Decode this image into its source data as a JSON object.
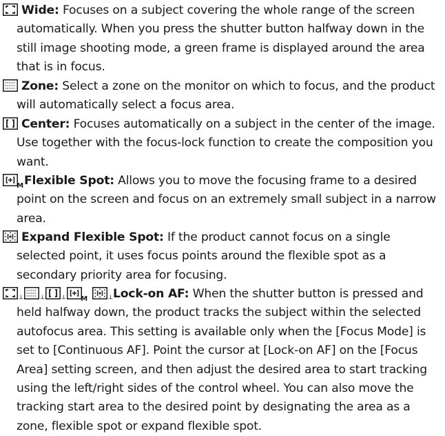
{
  "items": [
    {
      "icon": "wide-focus-area-icon",
      "term": "Wide:",
      "text": " Focuses on a subject covering the whole range of the screen automatically. When you press the shutter button halfway down in the still image shooting mode, a green frame is displayed around the area that is in focus."
    },
    {
      "icon": "zone-focus-area-icon",
      "term": "Zone:",
      "text": " Select a zone on the monitor on which to focus, and the product will automatically select a focus area."
    },
    {
      "icon": "center-focus-area-icon",
      "term": "Center:",
      "text": " Focuses automatically on a subject in the center of the image. Use together with the focus-lock function to create the composition you want."
    },
    {
      "icon": "flexible-spot-m-icon",
      "icon_sub": "M",
      "term": "Flexible Spot:",
      "text": " Allows you to move the focusing frame to a desired point on the screen and focus on an extremely small subject in a narrow area."
    },
    {
      "icon": "expand-flexible-spot-icon",
      "term": "Expand Flexible Spot:",
      "text": " If the product cannot focus on a single selected point, it uses focus points around the flexible spot as a secondary priority area for focusing."
    },
    {
      "icons": [
        "lock-on-wide-icon",
        "lock-on-zone-icon",
        "lock-on-center-icon",
        "lock-on-flexible-spot-m-icon",
        "lock-on-expand-flexible-spot-icon"
      ],
      "icon_sub": "M",
      "term": "Lock-on AF:",
      "text": " When the shutter button is pressed and held halfway down, the product tracks the subject within the selected autofocus area. This setting is available only when the [Focus Mode] is set to [Continuous AF]. Point the cursor at [Lock-on AF] on the [Focus Area] setting screen, and then adjust the desired area to start tracking using the left/right sides of the control wheel. You can also move the tracking start area to the desired point by designating the area as a zone, flexible spot or expand flexible spot."
    }
  ]
}
